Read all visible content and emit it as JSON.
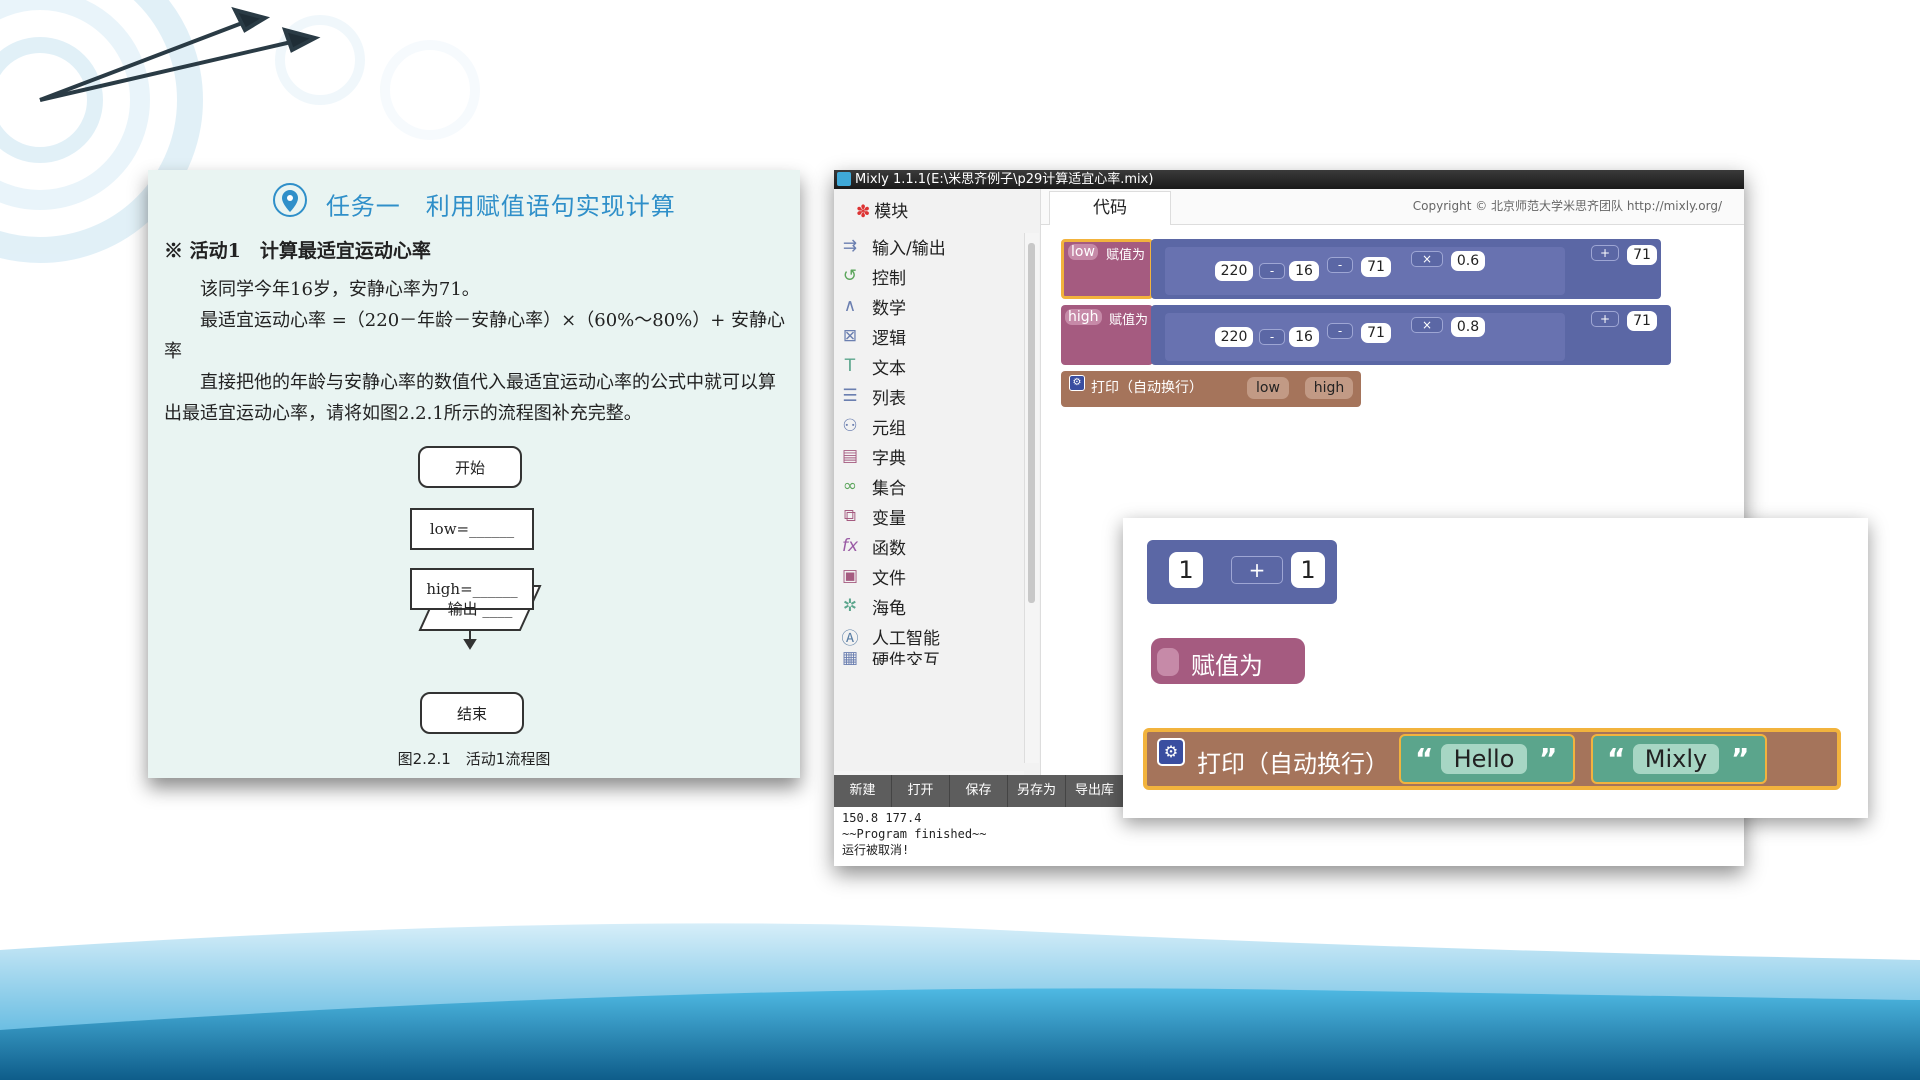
{
  "colors": {
    "book_bg": "#e9f4f2",
    "title_blue": "#2f8fc9",
    "math_block": "#5b67a5",
    "var_block": "#a55b80",
    "print_block": "#a5745b",
    "text_block": "#5ba58c",
    "highlight": "#f2b33d"
  },
  "book": {
    "title": "任务一　利用赋值语句实现计算",
    "activity": "※ 活动1　计算最适宜运动心率",
    "p1": "该同学今年16岁，安静心率为71。",
    "p2": "最适宜运动心率 =（220－年龄－安静心率）×（60%～80%）+ 安静心率",
    "p3": "直接把他的年龄与安静心率的数值代入最适宜运动心率的公式中就可以算出最适宜运动心率，请将如图2.2.1所示的流程图补充完整。",
    "flow": {
      "start": "开始",
      "low": "low=______",
      "high": "high=______",
      "output": "输出 ____",
      "end": "结束"
    },
    "caption": "图2.2.1　活动1流程图"
  },
  "window": {
    "title": "Mixly 1.1.1(E:\\米思齐例子\\p29计算适宜心率.mix)",
    "modules_label": "模块",
    "categories": [
      {
        "label": "输入/输出",
        "icon": "io-icon"
      },
      {
        "label": "控制",
        "icon": "control-icon"
      },
      {
        "label": "数学",
        "icon": "math-icon"
      },
      {
        "label": "逻辑",
        "icon": "logic-icon"
      },
      {
        "label": "文本",
        "icon": "text-icon"
      },
      {
        "label": "列表",
        "icon": "list-icon"
      },
      {
        "label": "元组",
        "icon": "tuple-icon"
      },
      {
        "label": "字典",
        "icon": "dict-icon"
      },
      {
        "label": "集合",
        "icon": "set-icon"
      },
      {
        "label": "变量",
        "icon": "variable-icon"
      },
      {
        "label": "函数",
        "icon": "function-icon"
      },
      {
        "label": "文件",
        "icon": "file-icon"
      },
      {
        "label": "海龟",
        "icon": "turtle-icon"
      },
      {
        "label": "人工智能",
        "icon": "ai-icon"
      },
      {
        "label": "硬件交互",
        "icon": "hardware-icon"
      }
    ],
    "tab_code": "代码",
    "copyright": "Copyright © 北京师范大学米思齐团队 http://mixly.org/",
    "toolbar": [
      "新建",
      "打开",
      "保存",
      "另存为",
      "导出库"
    ],
    "console": [
      "150.8 177.4",
      "~~Program finished~~",
      "运行被取消!"
    ]
  },
  "blocks": {
    "low": {
      "var": "low",
      "assign": "赋值为",
      "a": "220",
      "op1": "-",
      "b": "16",
      "op2": "-",
      "c": "71",
      "op3": "×",
      "d": "0.6",
      "op4": "+",
      "e": "71"
    },
    "high": {
      "var": "high",
      "assign": "赋值为",
      "a": "220",
      "op1": "-",
      "b": "16",
      "op2": "-",
      "c": "71",
      "op3": "×",
      "d": "0.8",
      "op4": "+",
      "e": "71"
    },
    "print": {
      "label": "打印（自动换行）",
      "arg1": "low",
      "arg2": "high"
    }
  },
  "zoom": {
    "add": {
      "a": "1",
      "op": "+",
      "b": "1"
    },
    "assign": "赋值为",
    "print": {
      "label": "打印（自动换行）",
      "s1": "Hello",
      "s2": "Mixly",
      "q_open": "“",
      "q_close": "”"
    }
  }
}
